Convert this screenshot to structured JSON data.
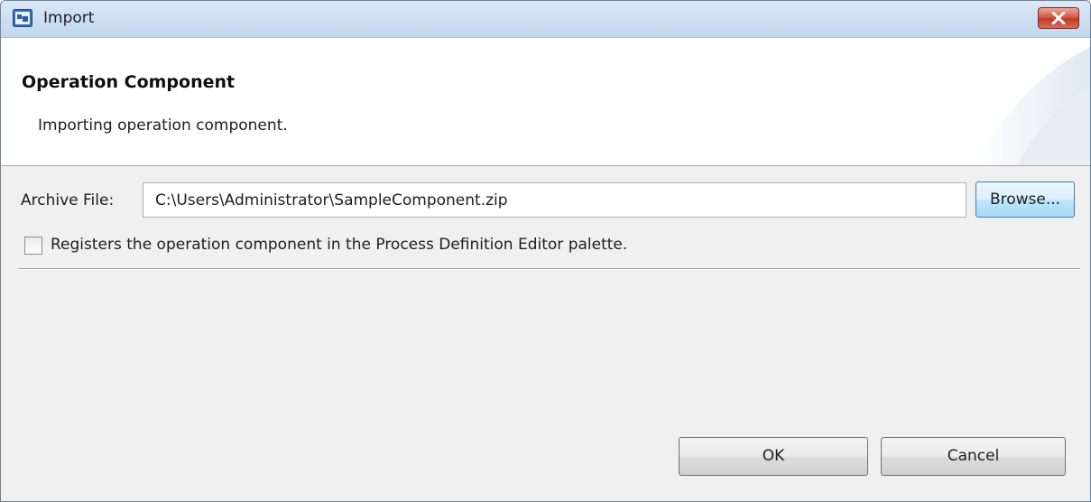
{
  "window": {
    "title": "Import",
    "icon": "app-icon",
    "close_icon": "close-icon"
  },
  "banner": {
    "title": "Operation Component",
    "description": "Importing operation component."
  },
  "form": {
    "archive_label": "Archive File:",
    "archive_value": "C:\\Users\\Administrator\\SampleComponent.zip",
    "browse_label": "Browse...",
    "register_checked": false,
    "register_label": "Registers the operation component in the Process Definition Editor palette."
  },
  "buttons": {
    "ok_label": "OK",
    "cancel_label": "Cancel"
  },
  "colors": {
    "title_bar": "#c9dcf0",
    "close_button": "#c83d2a",
    "dialog_bg": "#f0f0f0",
    "banner_bg": "#ffffff"
  }
}
